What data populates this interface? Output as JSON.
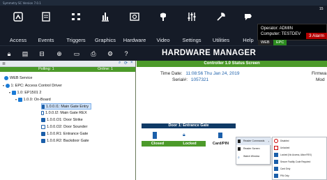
{
  "window": {
    "title": "Symmetry SC Version 7.0.1"
  },
  "nav": {
    "items": [
      {
        "label": "Access",
        "icon": "access-icon"
      },
      {
        "label": "Events",
        "icon": "events-icon"
      },
      {
        "label": "Triggers",
        "icon": "triggers-icon"
      },
      {
        "label": "Graphics",
        "icon": "graphics-icon"
      },
      {
        "label": "Hardware",
        "icon": "hardware-icon"
      },
      {
        "label": "Video",
        "icon": "video-icon"
      },
      {
        "label": "Settings",
        "icon": "settings-icon"
      },
      {
        "label": "Utilities",
        "icon": "utilities-icon"
      },
      {
        "label": "Help",
        "icon": "help-icon"
      }
    ]
  },
  "operator": {
    "operator_line": "Operator: ADMIN",
    "computer_line": "Computer: TESTDEV",
    "alarm_text": "3 Alarm",
    "web_label": "WEB",
    "epc_label": "EPC",
    "top_fragment": "15"
  },
  "page": {
    "title": "HARDWARE MANAGER"
  },
  "left_pane": {
    "polling_label": "Polling: 1",
    "online_label": "Online: 1",
    "tree": [
      "WEB Service",
      "1:  EPC: Access Control Driver",
      "1.0:  EP1501 2",
      "1.0.0:  On-Board",
      "1.0.0.I1:  Main Gate Entry",
      "1.0.0.I2:  Main Gate REX",
      "1.0.0.O1:  Door Strike",
      "1.0.0.O2:  Door Sounder",
      "1.0.0.R1:  Entrance Gate",
      "1.0.0.R2:  Backdoor Gate"
    ]
  },
  "right_pane": {
    "header": "Controller 1.0 Status Screen",
    "time_label": "Time Date:",
    "time_value": "11:08:56  Thu Jan 24, 2019",
    "serial_label": "Serial#:",
    "serial_value": "1057321",
    "firmware_label": "Firmwa",
    "model_label": "Mod",
    "aux_output": "Auxiliary Output",
    "door_header": "Door 1: Entrance Gate",
    "door_status": {
      "closed": "Closed",
      "locked": "Locked",
      "card_pin": "Card/PIN"
    }
  },
  "context_menu": {
    "items": [
      "Reader Commands",
      "Reader Screen",
      "Watch Window"
    ]
  },
  "submenu": {
    "items": [
      "Disabled",
      "Unlocked",
      "Locked (No Access, Allow REX)",
      "Secure Facility Code Required",
      "Card Only",
      "PIN Only"
    ]
  },
  "colors": {
    "nav_bg": "#151b27",
    "status_green": "#4c9a2a",
    "dark_blue": "#0f3a66",
    "alarm_red": "#b30000",
    "selection": "#cfe3fb"
  }
}
